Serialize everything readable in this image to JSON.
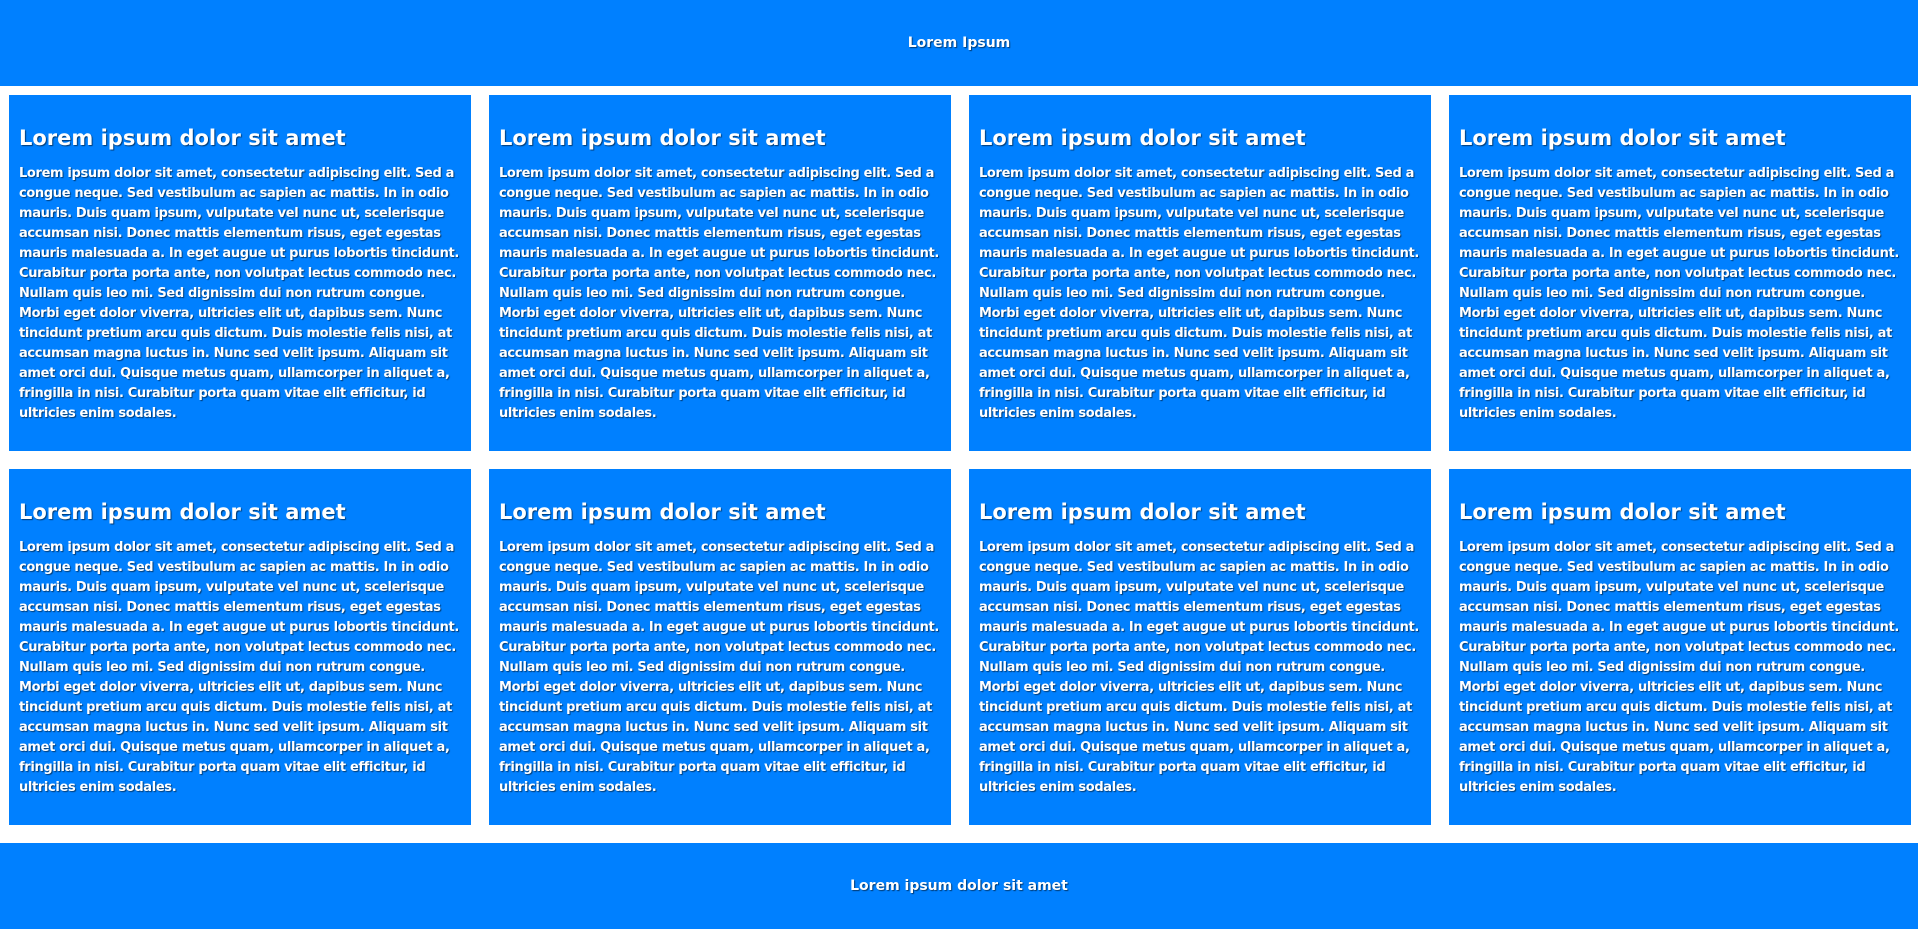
{
  "header": {
    "title": "Lorem Ipsum"
  },
  "cards": [
    {
      "title": "Lorem ipsum dolor sit amet",
      "body": "Lorem ipsum dolor sit amet, consectetur adipiscing elit. Sed a congue neque. Sed vestibulum ac sapien ac mattis. In in odio mauris. Duis quam ipsum, vulputate vel nunc ut, scelerisque accumsan nisi. Donec mattis elementum risus, eget egestas mauris malesuada a. In eget augue ut purus lobortis tincidunt. Curabitur porta porta ante, non volutpat lectus commodo nec. Nullam quis leo mi. Sed dignissim dui non rutrum congue. Morbi eget dolor viverra, ultricies elit ut, dapibus sem. Nunc tincidunt pretium arcu quis dictum. Duis molestie felis nisi, at accumsan magna luctus in. Nunc sed velit ipsum. Aliquam sit amet orci dui. Quisque metus quam, ullamcorper in aliquet a, fringilla in nisi. Curabitur porta quam vitae elit efficitur, id ultricies enim sodales."
    },
    {
      "title": "Lorem ipsum dolor sit amet",
      "body": "Lorem ipsum dolor sit amet, consectetur adipiscing elit. Sed a congue neque. Sed vestibulum ac sapien ac mattis. In in odio mauris. Duis quam ipsum, vulputate vel nunc ut, scelerisque accumsan nisi. Donec mattis elementum risus, eget egestas mauris malesuada a. In eget augue ut purus lobortis tincidunt. Curabitur porta porta ante, non volutpat lectus commodo nec. Nullam quis leo mi. Sed dignissim dui non rutrum congue. Morbi eget dolor viverra, ultricies elit ut, dapibus sem. Nunc tincidunt pretium arcu quis dictum. Duis molestie felis nisi, at accumsan magna luctus in. Nunc sed velit ipsum. Aliquam sit amet orci dui. Quisque metus quam, ullamcorper in aliquet a, fringilla in nisi. Curabitur porta quam vitae elit efficitur, id ultricies enim sodales."
    },
    {
      "title": "Lorem ipsum dolor sit amet",
      "body": "Lorem ipsum dolor sit amet, consectetur adipiscing elit. Sed a congue neque. Sed vestibulum ac sapien ac mattis. In in odio mauris. Duis quam ipsum, vulputate vel nunc ut, scelerisque accumsan nisi. Donec mattis elementum risus, eget egestas mauris malesuada a. In eget augue ut purus lobortis tincidunt. Curabitur porta porta ante, non volutpat lectus commodo nec. Nullam quis leo mi. Sed dignissim dui non rutrum congue. Morbi eget dolor viverra, ultricies elit ut, dapibus sem. Nunc tincidunt pretium arcu quis dictum. Duis molestie felis nisi, at accumsan magna luctus in. Nunc sed velit ipsum. Aliquam sit amet orci dui. Quisque metus quam, ullamcorper in aliquet a, fringilla in nisi. Curabitur porta quam vitae elit efficitur, id ultricies enim sodales."
    },
    {
      "title": "Lorem ipsum dolor sit amet",
      "body": "Lorem ipsum dolor sit amet, consectetur adipiscing elit. Sed a congue neque. Sed vestibulum ac sapien ac mattis. In in odio mauris. Duis quam ipsum, vulputate vel nunc ut, scelerisque accumsan nisi. Donec mattis elementum risus, eget egestas mauris malesuada a. In eget augue ut purus lobortis tincidunt. Curabitur porta porta ante, non volutpat lectus commodo nec. Nullam quis leo mi. Sed dignissim dui non rutrum congue. Morbi eget dolor viverra, ultricies elit ut, dapibus sem. Nunc tincidunt pretium arcu quis dictum. Duis molestie felis nisi, at accumsan magna luctus in. Nunc sed velit ipsum. Aliquam sit amet orci dui. Quisque metus quam, ullamcorper in aliquet a, fringilla in nisi. Curabitur porta quam vitae elit efficitur, id ultricies enim sodales."
    },
    {
      "title": "Lorem ipsum dolor sit amet",
      "body": "Lorem ipsum dolor sit amet, consectetur adipiscing elit. Sed a congue neque. Sed vestibulum ac sapien ac mattis. In in odio mauris. Duis quam ipsum, vulputate vel nunc ut, scelerisque accumsan nisi. Donec mattis elementum risus, eget egestas mauris malesuada a. In eget augue ut purus lobortis tincidunt. Curabitur porta porta ante, non volutpat lectus commodo nec. Nullam quis leo mi. Sed dignissim dui non rutrum congue. Morbi eget dolor viverra, ultricies elit ut, dapibus sem. Nunc tincidunt pretium arcu quis dictum. Duis molestie felis nisi, at accumsan magna luctus in. Nunc sed velit ipsum. Aliquam sit amet orci dui. Quisque metus quam, ullamcorper in aliquet a, fringilla in nisi. Curabitur porta quam vitae elit efficitur, id ultricies enim sodales."
    },
    {
      "title": "Lorem ipsum dolor sit amet",
      "body": "Lorem ipsum dolor sit amet, consectetur adipiscing elit. Sed a congue neque. Sed vestibulum ac sapien ac mattis. In in odio mauris. Duis quam ipsum, vulputate vel nunc ut, scelerisque accumsan nisi. Donec mattis elementum risus, eget egestas mauris malesuada a. In eget augue ut purus lobortis tincidunt. Curabitur porta porta ante, non volutpat lectus commodo nec. Nullam quis leo mi. Sed dignissim dui non rutrum congue. Morbi eget dolor viverra, ultricies elit ut, dapibus sem. Nunc tincidunt pretium arcu quis dictum. Duis molestie felis nisi, at accumsan magna luctus in. Nunc sed velit ipsum. Aliquam sit amet orci dui. Quisque metus quam, ullamcorper in aliquet a, fringilla in nisi. Curabitur porta quam vitae elit efficitur, id ultricies enim sodales."
    },
    {
      "title": "Lorem ipsum dolor sit amet",
      "body": "Lorem ipsum dolor sit amet, consectetur adipiscing elit. Sed a congue neque. Sed vestibulum ac sapien ac mattis. In in odio mauris. Duis quam ipsum, vulputate vel nunc ut, scelerisque accumsan nisi. Donec mattis elementum risus, eget egestas mauris malesuada a. In eget augue ut purus lobortis tincidunt. Curabitur porta porta ante, non volutpat lectus commodo nec. Nullam quis leo mi. Sed dignissim dui non rutrum congue. Morbi eget dolor viverra, ultricies elit ut, dapibus sem. Nunc tincidunt pretium arcu quis dictum. Duis molestie felis nisi, at accumsan magna luctus in. Nunc sed velit ipsum. Aliquam sit amet orci dui. Quisque metus quam, ullamcorper in aliquet a, fringilla in nisi. Curabitur porta quam vitae elit efficitur, id ultricies enim sodales."
    },
    {
      "title": "Lorem ipsum dolor sit amet",
      "body": "Lorem ipsum dolor sit amet, consectetur adipiscing elit. Sed a congue neque. Sed vestibulum ac sapien ac mattis. In in odio mauris. Duis quam ipsum, vulputate vel nunc ut, scelerisque accumsan nisi. Donec mattis elementum risus, eget egestas mauris malesuada a. In eget augue ut purus lobortis tincidunt. Curabitur porta porta ante, non volutpat lectus commodo nec. Nullam quis leo mi. Sed dignissim dui non rutrum congue. Morbi eget dolor viverra, ultricies elit ut, dapibus sem. Nunc tincidunt pretium arcu quis dictum. Duis molestie felis nisi, at accumsan magna luctus in. Nunc sed velit ipsum. Aliquam sit amet orci dui. Quisque metus quam, ullamcorper in aliquet a, fringilla in nisi. Curabitur porta quam vitae elit efficitur, id ultricies enim sodales."
    }
  ],
  "footer": {
    "text": "Lorem ipsum dolor sit amet"
  },
  "colors": {
    "panel_background": "#0080ff",
    "page_background": "#ffffff",
    "text": "#ffffff"
  }
}
